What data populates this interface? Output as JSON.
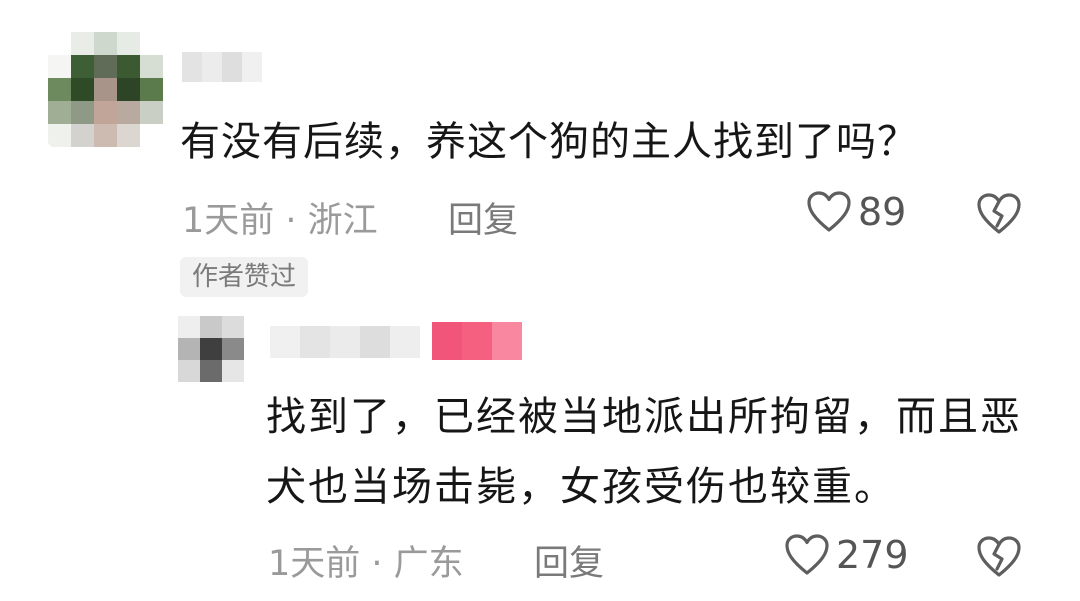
{
  "comment": {
    "text": "有没有后续，养这个狗的主人找到了吗？",
    "time_location": "1天前 · 浙江",
    "reply_label": "回复",
    "likes": "89",
    "author_liked_badge": "作者赞过"
  },
  "reply": {
    "text": "找到了，已经被当地派出所拘留，而且恶犬也当场击毙，女孩受伤也较重。",
    "time_location": "1天前 · 广东",
    "reply_label": "回复",
    "likes": "279"
  },
  "icons": {
    "like": "heart-outline-icon",
    "dislike": "broken-heart-icon"
  },
  "colors": {
    "text": "#161616",
    "meta": "#9a9a9a",
    "badge_bg": "#f1f1f1",
    "badge_text": "#7b7b7b",
    "author_tag": "#f25a7a"
  }
}
